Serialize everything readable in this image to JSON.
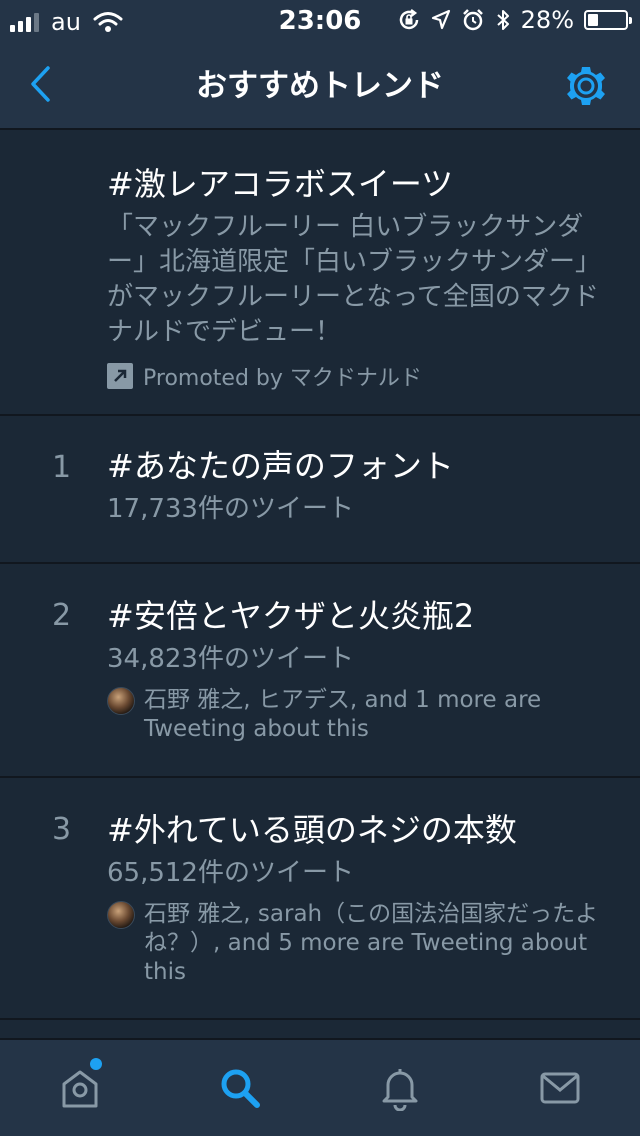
{
  "status_bar": {
    "carrier": "au",
    "time": "23:06",
    "battery": "28%",
    "battery_level": 0.28
  },
  "nav": {
    "title": "おすすめトレンド",
    "back_icon": "chevron-left-icon",
    "settings_icon": "gear-icon"
  },
  "colors": {
    "accent": "#1da1f2",
    "background": "#1b2836",
    "bar": "#243447",
    "secondary_text": "#8899a6"
  },
  "trends": [
    {
      "rank": "",
      "title": "#激レアコラボスイーツ",
      "description": "「マックフルーリー 白いブラックサンダー」北海道限定「白いブラックサンダー」がマックフルーリーとなって全国のマクドナルドでデビュー！",
      "promoted": "Promoted by マクドナルド"
    },
    {
      "rank": "1",
      "title": "#あなたの声のフォント",
      "count": "17,733件のツイート"
    },
    {
      "rank": "2",
      "title": "#安倍とヤクザと火炎瓶2",
      "count": "34,823件のツイート",
      "social": "石野 雅之, ヒアデス, and 1 more are Tweeting about this"
    },
    {
      "rank": "3",
      "title": "#外れている頭のネジの本数",
      "count": "65,512件のツイート",
      "social": "石野 雅之, sarah（この国法治国家だったよね？）, and 5 more are Tweeting about this"
    }
  ],
  "tabs": [
    {
      "name": "home",
      "icon": "home-icon",
      "active": false,
      "badge": true
    },
    {
      "name": "search",
      "icon": "search-icon",
      "active": true,
      "badge": false
    },
    {
      "name": "notifications",
      "icon": "bell-icon",
      "active": false,
      "badge": false
    },
    {
      "name": "messages",
      "icon": "envelope-icon",
      "active": false,
      "badge": false
    }
  ]
}
